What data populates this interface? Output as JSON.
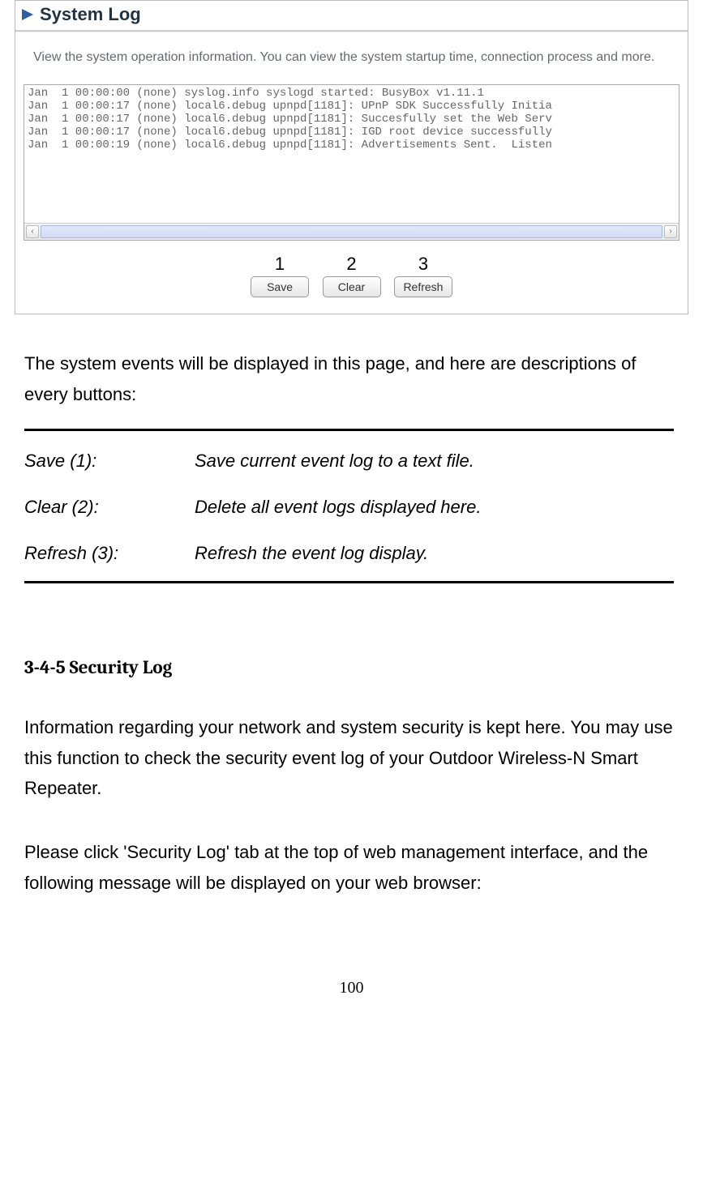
{
  "panel": {
    "title": "System Log",
    "description": "View the system operation information. You can view the system startup time, connection process and more.",
    "log_lines": "Jan  1 00:00:00 (none) syslog.info syslogd started: BusyBox v1.11.1\nJan  1 00:00:17 (none) local6.debug upnpd[1181]: UPnP SDK Successfully Initia\nJan  1 00:00:17 (none) local6.debug upnpd[1181]: Succesfully set the Web Serv\nJan  1 00:00:17 (none) local6.debug upnpd[1181]: IGD root device successfully\nJan  1 00:00:19 (none) local6.debug upnpd[1181]: Advertisements Sent.  Listen",
    "numbers": {
      "n1": "1",
      "n2": "2",
      "n3": "3"
    },
    "buttons": {
      "save": "Save",
      "clear": "Clear",
      "refresh": "Refresh"
    },
    "scroll": {
      "left": "‹",
      "right": "›"
    }
  },
  "body": {
    "intro": "The system events will be displayed in this page, and here are descriptions of every buttons:",
    "rows": [
      {
        "label": "Save (1):",
        "desc": "Save current event log to a text file."
      },
      {
        "label": "Clear (2):",
        "desc": "Delete all event logs displayed here."
      },
      {
        "label": "Refresh (3):",
        "desc": "Refresh the event log display."
      }
    ],
    "heading": "3-4-5 Security Log",
    "p1": "Information regarding your network and system security is kept here.    You may use this function to check the security event log of your Outdoor Wireless-N Smart Repeater.",
    "p2": "Please click 'Security Log' tab at the top of web management interface, and the following message will be displayed on your web browser:"
  },
  "page_number": "100"
}
